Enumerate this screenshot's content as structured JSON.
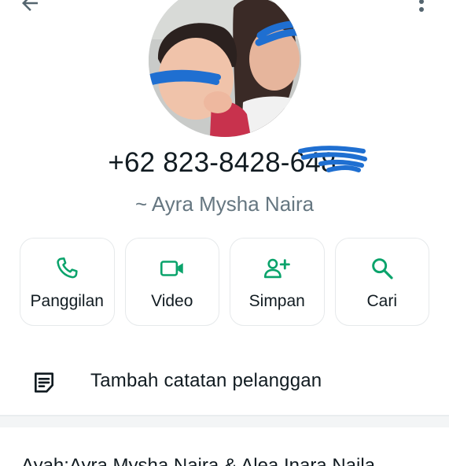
{
  "contact": {
    "phone": "+62 823-8428-648",
    "name": "~ Ayra Mysha Naira"
  },
  "actions": [
    {
      "label": "Panggilan",
      "icon": "phone-icon"
    },
    {
      "label": "Video",
      "icon": "video-camera-icon"
    },
    {
      "label": "Simpan",
      "icon": "add-person-icon"
    },
    {
      "label": "Cari",
      "icon": "search-icon"
    }
  ],
  "note": {
    "label": "Tambah catatan pelanggan",
    "icon": "note-icon"
  },
  "about": {
    "text": "Ayah:Ayra Mysha Naira & Alea Inara Naila"
  },
  "icons": {
    "back": "back-arrow-icon",
    "more": "more-vertical-icon"
  },
  "colors": {
    "accent": "#0aa36b",
    "text": "#111b21",
    "secondary_text": "#667781",
    "border": "#e6e9eb",
    "redaction": "#1f6fd1"
  }
}
